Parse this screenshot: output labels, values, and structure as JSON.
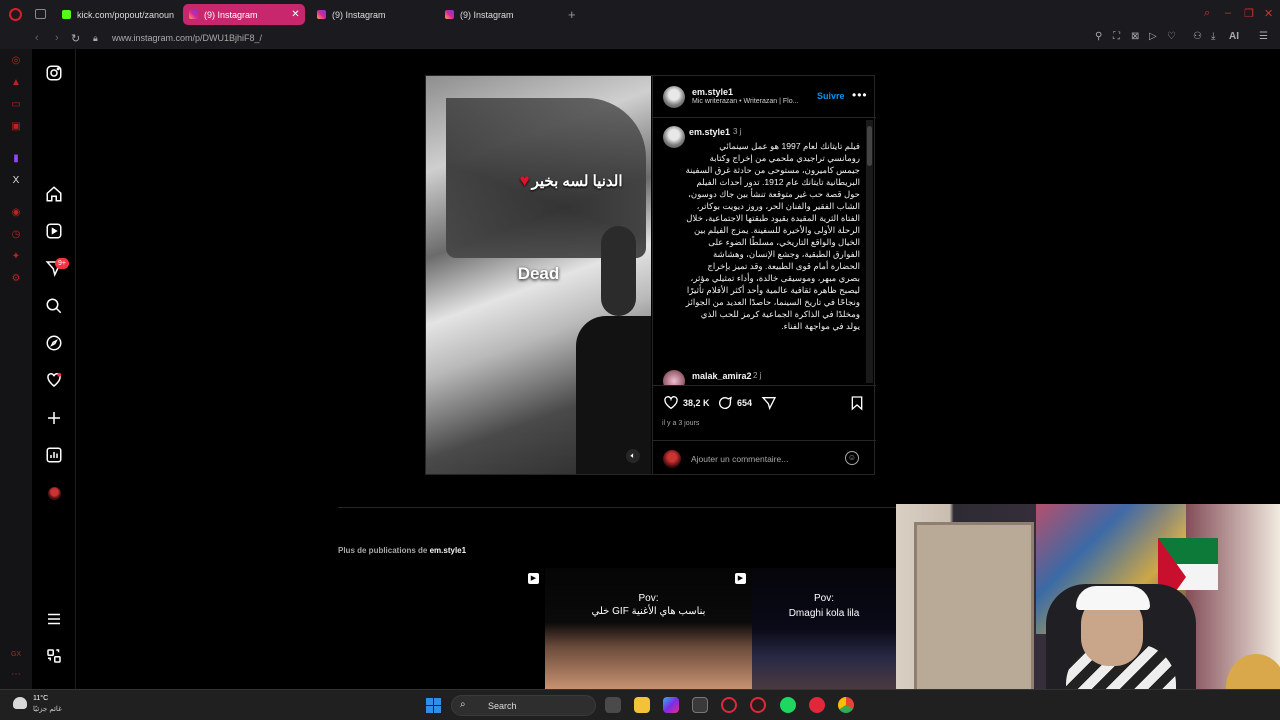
{
  "browser": {
    "tabs": [
      {
        "label": "kick.com/popout/zanouni",
        "favicon": "kick-icon"
      },
      {
        "label": "(9) Instagram",
        "favicon": "instagram-icon",
        "active": true
      },
      {
        "label": "(9) Instagram",
        "favicon": "instagram-icon"
      },
      {
        "label": "(9) Instagram",
        "favicon": "instagram-icon"
      }
    ],
    "url": "www.instagram.com/p/DWU1BjhiF8_/",
    "ai_label": "AI"
  },
  "nav": {
    "badge": "9+"
  },
  "post": {
    "author": "em.style1",
    "subline": "Mic writerazan • Writerazan | Flo...",
    "follow_label": "Suivre",
    "overlay_arabic": "الدنيا لسه بخير",
    "overlay_dead": "Dead",
    "caption_author": "em.style1",
    "caption_time": "3 j",
    "caption": "فيلم تايتانك لعام 1997 هو عمل سينمائي رومانسي تراجيدي ملحمي من إخراج وكتابة جيمس كاميرون، مستوحى من حادثة غرق السفينة البريطانية تايتانك عام 1912. تدور أحداث الفيلم حول قصة حب غير متوقعة تنشأ بين جاك دوسون، الشاب الفقير والفنان الحر، وروز ديويت بوكاتر، الفتاة الثرية المقيدة بقيود طبقتها الاجتماعية، خلال الرحلة الأولى والأخيرة للسفينة. يمزج الفيلم بين الخيال والواقع التاريخي، مسلطًا الضوء على الفوارق الطبقية، وجشع الإنسان، وهشاشة الحضارة أمام قوى الطبيعة. وقد تميز بإخراج بصري مبهر، وموسيقى خالدة، وأداء تمثيلي مؤثر، ليصبح ظاهرة ثقافية عالمية وأحد أكثر الأفلام تأثيرًا ونجاحًا في تاريخ السينما، حاصدًا العديد من الجوائز ومخلدًا في الذاكرة الجماعية كرمز للحب الذي يولد في مواجهة الفناء.",
    "next_comment_author": "malak_amira2",
    "next_comment_time": "2 j",
    "likes": "38,2 K",
    "comments": "654",
    "date": "il y a 3 jours",
    "comment_placeholder": "Ajouter un commentaire..."
  },
  "more": {
    "prefix": "Plus de publications de",
    "author": "em.style1",
    "thumbs": [
      {
        "line1": "",
        "line2": ""
      },
      {
        "line1": "Pov:",
        "line2": "خلي GIF بناسب هاي الأغنية"
      },
      {
        "line1": "Pov:",
        "line2": "Dmaghi kola lila"
      }
    ]
  },
  "taskbar": {
    "temp": "11°C",
    "weather": "غائم جزئيًا",
    "search_label": "Search"
  },
  "colors": {
    "accent_tab": "#c8266d",
    "follow_blue": "#0095f6",
    "notif_red": "#ff3040"
  }
}
